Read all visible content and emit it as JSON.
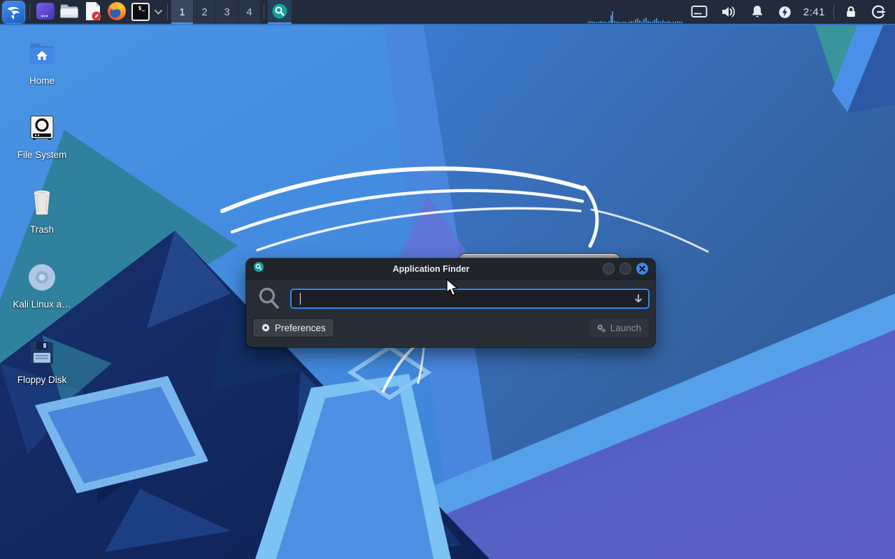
{
  "colors": {
    "accent": "#3584e4",
    "panel_bg": "#222b3b",
    "panel_underline": "#4a90d9",
    "dialog_bg": "#282d35",
    "titlebar_bg": "#20242b",
    "appfinder_teal": "#12a39e",
    "close_button_blue": "#3d87e9"
  },
  "panel": {
    "terminal_glyph": "$_",
    "workspaces": [
      "1",
      "2",
      "3",
      "4"
    ],
    "active_workspace": "1",
    "clock": "2:41",
    "icons": {
      "launchers": [
        "kali-menu",
        "undercover-window",
        "file-manager",
        "text-editor",
        "firefox",
        "terminal",
        "terminal-dropdown"
      ],
      "tray": [
        "display",
        "volume",
        "notifications-bell",
        "power-manager",
        "lock",
        "logout"
      ]
    }
  },
  "desktop": {
    "icons": [
      {
        "label": "Home"
      },
      {
        "label": "File System"
      },
      {
        "label": "Trash"
      },
      {
        "label": "Kali Linux a…"
      },
      {
        "label": "Floppy Disk"
      }
    ]
  },
  "finder": {
    "title": "Application Finder",
    "search": {
      "value": "",
      "placeholder": ""
    },
    "preferences_label": "Preferences",
    "launch_label": "Launch"
  }
}
